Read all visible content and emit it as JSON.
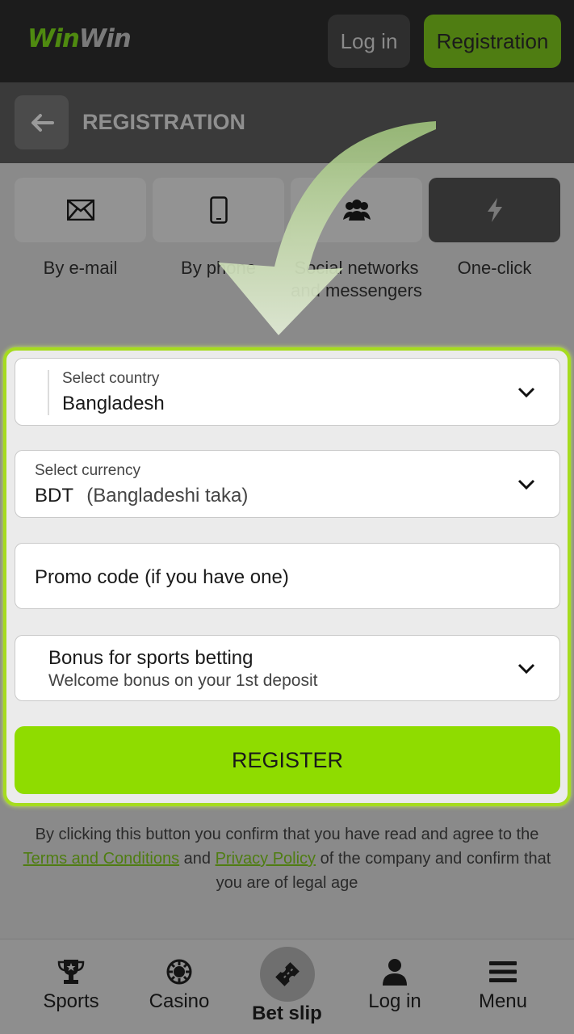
{
  "header": {
    "logo_part1": "Win",
    "logo_part2": "Win",
    "login_label": "Log in",
    "registration_label": "Registration"
  },
  "subheader": {
    "title": "REGISTRATION"
  },
  "methods": [
    {
      "label": "By e-mail",
      "icon": "envelope-icon"
    },
    {
      "label": "By phone",
      "icon": "phone-icon"
    },
    {
      "label": "Social networks and messengers",
      "icon": "users-icon"
    },
    {
      "label": "One-click",
      "icon": "lightning-icon"
    }
  ],
  "form": {
    "country_label": "Select country",
    "country_value": "Bangladesh",
    "currency_label": "Select currency",
    "currency_code": "BDT",
    "currency_name": "(Bangladeshi taka)",
    "promo_placeholder": "Promo code (if you have one)",
    "bonus_title": "Bonus for sports betting",
    "bonus_subtitle": "Welcome bonus on your 1st deposit",
    "register_label": "REGISTER"
  },
  "disclaimer": {
    "before": "By clicking this button you confirm that you have read and agree to the ",
    "terms": "Terms and Conditions",
    "and": " and ",
    "privacy": "Privacy Policy",
    "after": " of the company and confirm that you are of legal age"
  },
  "bottom_nav": {
    "sports": "Sports",
    "casino": "Casino",
    "bet_slip": "Bet slip",
    "login": "Log in",
    "menu": "Menu"
  },
  "colors": {
    "accent": "#8fdc00",
    "header_bg": "#1c1c1c",
    "form_border": "#a6dc1f"
  }
}
